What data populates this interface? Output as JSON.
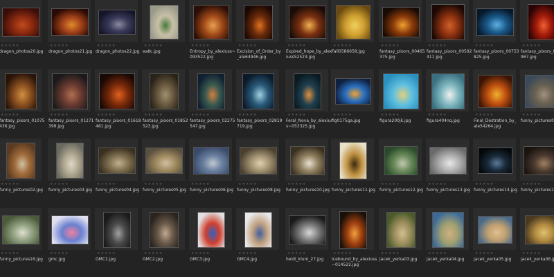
{
  "rows": [
    [
      {
        "name": "dragon_photos20.jpg",
        "c1": "#3a0d08",
        "c2": "#8a2a10",
        "c3": "#c04a1a"
      },
      {
        "name": "dragon_photos21.jpg",
        "c1": "#2a0a04",
        "c2": "#a0401a",
        "c3": "#e08a2a"
      },
      {
        "name": "dragon_photos22.jpg",
        "c1": "#15152a",
        "c2": "#3a3a5a",
        "c3": "#8a8aa0"
      },
      {
        "name": "ea8c.jpg",
        "c1": "#9a9a8a",
        "c2": "#c8c0a8",
        "c3": "#4a7a3a"
      },
      {
        "name": "Entropy_by_alexiuss~\n093522.jpg",
        "c1": "#2a0e06",
        "c2": "#a04818",
        "c3": "#e8a050"
      },
      {
        "name": "Excision_of_Order_by\n_ale64946.jpg",
        "c1": "#1a0804",
        "c2": "#6a2a0a",
        "c3": "#e07020"
      },
      {
        "name": "Expired_hope_by_alex\niuss52523.jpg",
        "c1": "#1a0c08",
        "c2": "#7a3010",
        "c3": "#f0b050"
      },
      {
        "name": "Fall0586658.jpg",
        "c1": "#6a4a10",
        "c2": "#d0a030",
        "c3": "#f0d060"
      },
      {
        "name": "fantasy_pixors_00465\n375.jpg",
        "c1": "#180a04",
        "c2": "#8a3a0a",
        "c3": "#f0a030"
      },
      {
        "name": "fantasy_pixors_00592\n411.jpg",
        "c1": "#1a0804",
        "c2": "#8a3010",
        "c3": "#d06028"
      },
      {
        "name": "fantasy_pixors_00753\n825.jpg",
        "c1": "#08182a",
        "c2": "#1a5a8a",
        "c3": "#60b0e0"
      },
      {
        "name": "fantasy_pixors_00\n967.jpg",
        "c1": "#2a0404",
        "c2": "#a01a0a",
        "c3": "#f06030"
      }
    ],
    [
      {
        "name": "fantasy_pixors_01075\n436.jpg",
        "c1": "#2a1408",
        "c2": "#8a5020",
        "c3": "#d09040"
      },
      {
        "name": "fantasy_pixors_01271\n399.jpg",
        "c1": "#1a1a1a",
        "c2": "#6a3a30",
        "c3": "#b07050"
      },
      {
        "name": "fantasy_pixors_01618\n481.jpg",
        "c1": "#1a0804",
        "c2": "#7a2a0a",
        "c3": "#e06020"
      },
      {
        "name": "fantasy_pixors_01852\n523.jpg",
        "c1": "#2a2418",
        "c2": "#6a5a40",
        "c3": "#a09070"
      },
      {
        "name": "fantasy_pixors_02275\n547.jpg",
        "c1": "#102030",
        "c2": "#3a5a50",
        "c3": "#d08040"
      },
      {
        "name": "fantasy_pixors_02819\n719.jpg",
        "c1": "#0a1a2a",
        "c2": "#2a5a7a",
        "c3": "#a0d0e0"
      },
      {
        "name": "Feral_Nova_by_alexius\ns~053325.jpg",
        "c1": "#0a1a20",
        "c2": "#204050",
        "c3": "#e09040"
      },
      {
        "name": "fig0175ga.jpg",
        "c1": "#102040",
        "c2": "#2a70c0",
        "c3": "#f0a030"
      },
      {
        "name": "figura200jk.jpg",
        "c1": "#2a90c0",
        "c2": "#60c0e0",
        "c3": "#e0d080"
      },
      {
        "name": "figura404nq.jpg",
        "c1": "#3a7080",
        "c2": "#80b8c0",
        "c3": "#f0f0f0"
      },
      {
        "name": "Final_Destration_by_\nale54264.jpg",
        "c1": "#3a1404",
        "c2": "#c05010",
        "c3": "#f0b030"
      },
      {
        "name": "funny_pictures01.",
        "c1": "#3a4a5a",
        "c2": "#6a6050",
        "c3": "#a09080"
      }
    ],
    [
      {
        "name": "funny_pictures02.jpg",
        "c1": "#5a3a20",
        "c2": "#a06a3a",
        "c3": "#d0c0a0"
      },
      {
        "name": "funny_pictures03.jpg",
        "c1": "#6a6a60",
        "c2": "#b0a890",
        "c3": "#e0d8c8"
      },
      {
        "name": "funny_pictures04.jpg",
        "c1": "#3a3020",
        "c2": "#807050",
        "c3": "#c0b090"
      },
      {
        "name": "funny_pictures05.jpg",
        "c1": "#5a5040",
        "c2": "#a08a60",
        "c3": "#d0c0a0"
      },
      {
        "name": "funny_pictures06.jpg",
        "c1": "#3a4a6a",
        "c2": "#6a80a0",
        "c3": "#c0c8d0"
      },
      {
        "name": "funny_pictures08.jpg",
        "c1": "#4a4030",
        "c2": "#a09070",
        "c3": "#e0d0b0"
      },
      {
        "name": "funny_pictures10.jpg",
        "c1": "#3a3020",
        "c2": "#908060",
        "c3": "#e8e0d0"
      },
      {
        "name": "funny_pictures11.jpg",
        "c1": "#e8e0c8",
        "c2": "#c09040",
        "c3": "#3a2a10"
      },
      {
        "name": "funny_pictures12.jpg",
        "c1": "#2a4a2a",
        "c2": "#6a8a5a",
        "c3": "#c0c8b0"
      },
      {
        "name": "funny_pictures13.jpg",
        "c1": "#6a6a6a",
        "c2": "#b0b0b0",
        "c3": "#e8e8e8"
      },
      {
        "name": "funny_pictures14.jpg",
        "c1": "#04080a",
        "c2": "#1a2a3a",
        "c3": "#5a7a9a"
      },
      {
        "name": "funny_pictures15.",
        "c1": "#1a1410",
        "c2": "#4a3a30",
        "c3": "#a08060"
      }
    ],
    [
      {
        "name": "funny_pictures16.jpg",
        "c1": "#4a5a3a",
        "c2": "#90a080",
        "c3": "#e0e0d0"
      },
      {
        "name": "gmc.jpg",
        "c1": "#e0e0f0",
        "c2": "#6a80d0",
        "c3": "#f080a0"
      },
      {
        "name": "GMC1.jpg",
        "c1": "#1a1a1a",
        "c2": "#4a4a4a",
        "c3": "#a0a0a0"
      },
      {
        "name": "GMC2.jpg",
        "c1": "#2a2420",
        "c2": "#6a5a4a",
        "c3": "#c0a890"
      },
      {
        "name": "GMC3.jpg",
        "c1": "#e0e0e0",
        "c2": "#d04030",
        "c3": "#3060c0"
      },
      {
        "name": "GMC4.jpg",
        "c1": "#e8e8e8",
        "c2": "#c0a080",
        "c3": "#4060a0"
      },
      {
        "name": "heidi_klum_27.jpg",
        "c1": "#1a1a1a",
        "c2": "#7a7a7a",
        "c3": "#d8d8d8"
      },
      {
        "name": "Icebound_by_alexiuss\n~014522.jpg",
        "c1": "#1a1008",
        "c2": "#a04010",
        "c3": "#f0a040"
      },
      {
        "name": "jacek_yerka03.jpg",
        "c1": "#4a5a2a",
        "c2": "#a09060",
        "c3": "#d0c090"
      },
      {
        "name": "jacek_yerka04.jpg",
        "c1": "#3a6a9a",
        "c2": "#a0a070",
        "c3": "#d0b080"
      },
      {
        "name": "jacek_yerka05.jpg",
        "c1": "#4a6a8a",
        "c2": "#c0a070",
        "c3": "#e0c090"
      },
      {
        "name": "jacek_yerka06.jpg",
        "c1": "#4a3a20",
        "c2": "#b08a40",
        "c3": "#e0c070"
      }
    ]
  ],
  "stars": "★★★★★"
}
